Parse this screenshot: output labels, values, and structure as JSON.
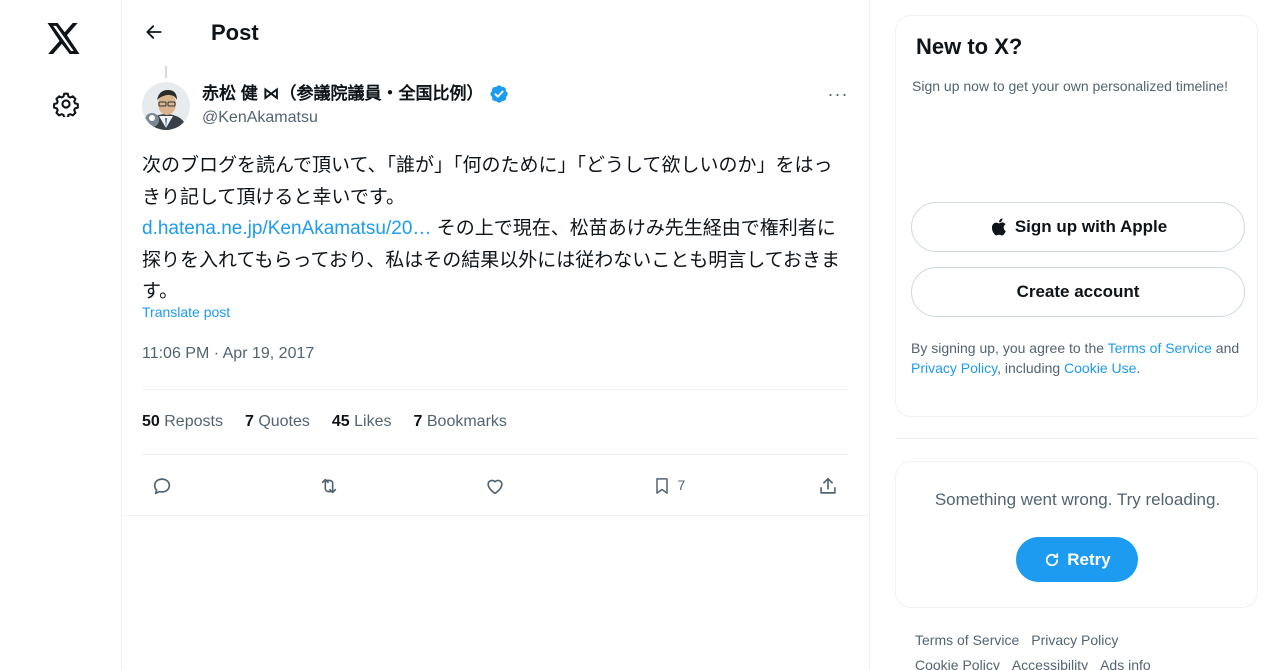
{
  "nav": {
    "logo_icon": "x-logo-icon",
    "settings_icon": "gear-icon"
  },
  "header": {
    "title": "Post",
    "back_icon": "arrow-left-icon"
  },
  "post": {
    "author_name": "赤松 健 ⋈（参議院議員・全国比例）",
    "author_handle": "@KenAkamatsu",
    "more_label": "···",
    "text_part1": "次のブログを読んで頂いて、「誰が」「何のために」「どうして欲しいのか」をはっきり記して頂けると幸いです。",
    "link_text": "d.hatena.ne.jp/KenAkamatsu/20…",
    "text_part2": " その上で現在、松苗あけみ先生経由で権利者に探りを入れてもらっており、私はその結果以外には従わないことも明言しておきます。",
    "translate_label": "Translate post",
    "timestamp": "11:06 PM · Apr 19, 2017",
    "stats": {
      "reposts_count": "50",
      "reposts_label": "Reposts",
      "quotes_count": "7",
      "quotes_label": "Quotes",
      "likes_count": "45",
      "likes_label": "Likes",
      "bookmarks_count": "7",
      "bookmarks_label": "Bookmarks"
    },
    "actions": {
      "bookmark_count": "7"
    }
  },
  "signup": {
    "title": "New to X?",
    "subtitle": "Sign up now to get your own personalized timeline!",
    "apple_button": "Sign up with Apple",
    "create_button": "Create account",
    "legal_prefix": "By signing up, you agree to the ",
    "terms_link": "Terms of Service",
    "legal_and": " and ",
    "privacy_link": "Privacy Policy",
    "legal_including": ", including ",
    "cookie_link": "Cookie Use",
    "legal_end": "."
  },
  "error_card": {
    "message": "Something went wrong. Try reloading.",
    "retry_label": "Retry"
  },
  "footer": {
    "links": [
      "Terms of Service",
      "Privacy Policy",
      "Cookie Policy",
      "Accessibility",
      "Ads info"
    ]
  },
  "colors": {
    "accent": "#1d9bf0",
    "text_primary": "#0f1419",
    "text_secondary": "#536471",
    "border": "#eff3f4"
  }
}
